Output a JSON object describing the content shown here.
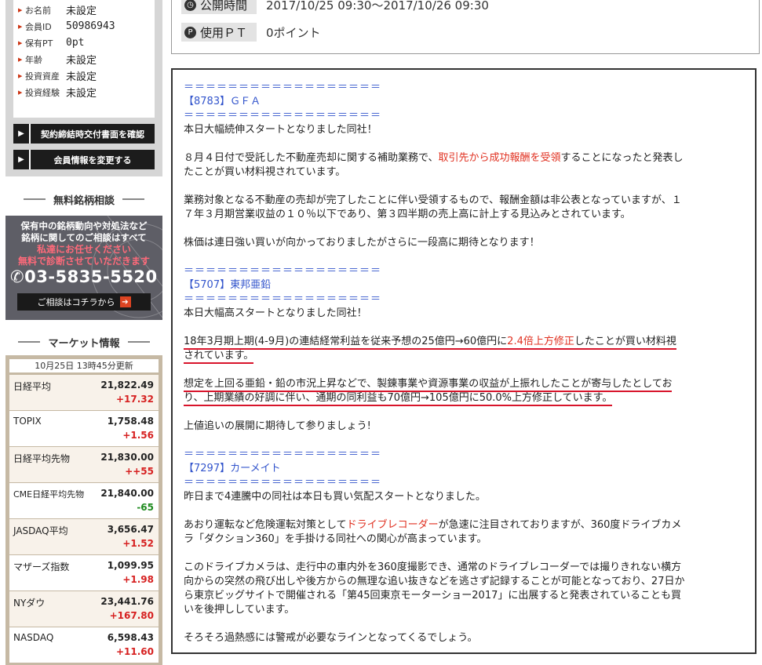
{
  "profile": {
    "rows": [
      {
        "label": "お名前",
        "value": "未設定"
      },
      {
        "label": "会員ID",
        "value": "50986943"
      },
      {
        "label": "保有PT",
        "value": "0pt"
      },
      {
        "label": "年齢",
        "value": "未設定"
      },
      {
        "label": "投資資産",
        "value": "未設定"
      },
      {
        "label": "投資経験",
        "value": "未設定"
      }
    ],
    "buttons": [
      "契約締結時交付書面を確認",
      "会員情報を変更する"
    ]
  },
  "consult": {
    "title": "無料銘柄相談",
    "line1": "保有中の銘柄動向や対処法など",
    "line2": "銘柄に関してのご相談はすべて",
    "line3": "私達にお任せください",
    "line4": "無料で診断させていただきます",
    "phone": "03-5835-5520",
    "button": "ご相談はコチラから"
  },
  "market": {
    "title": "マーケット情報",
    "updated": "10月25日 13時45分更新",
    "rows": [
      {
        "name": "日経平均",
        "price": "21,822.49",
        "change": "+17.32",
        "dir": "up"
      },
      {
        "name": "TOPIX",
        "price": "1,758.48",
        "change": "+1.56",
        "dir": "up"
      },
      {
        "name": "日経平均先物",
        "price": "21,830.00",
        "change": "++55",
        "dir": "up"
      },
      {
        "name": "CME日経平均先物",
        "price": "21,840.00",
        "change": "-65",
        "dir": "down"
      },
      {
        "name": "JASDAQ平均",
        "price": "3,656.47",
        "change": "+1.52",
        "dir": "up"
      },
      {
        "name": "マザーズ指数",
        "price": "1,099.95",
        "change": "+1.98",
        "dir": "up"
      },
      {
        "name": "NYダウ",
        "price": "23,441.76",
        "change": "+167.80",
        "dir": "up"
      },
      {
        "name": "NASDAQ",
        "price": "6,598.43",
        "change": "+11.60",
        "dir": "up"
      }
    ]
  },
  "info": {
    "publish_label": "公開時間",
    "publish_value": "2017/10/25 09:30～2017/10/26 09:30",
    "pt_label": "使用ＰＴ",
    "pt_value": "0ポイント"
  },
  "article": {
    "sep": "＝＝＝＝＝＝＝＝＝＝＝＝＝＝＝＝＝＝",
    "s1_code": "【8783】ＧＦＡ",
    "s1_p1": "本日大幅続伸スタートとなりました同社！",
    "s1_p2a": "８月４日付で受託した不動産売却に関する補助業務で、",
    "s1_p2b": "取引先から成功報酬を受領",
    "s1_p2c": "することになったと発表し",
    "s1_p2d": "たことが買い材料視されています。",
    "s1_p3a": "業務対象となる不動産の売却が完了したことに伴い受領するもので、報酬金額は非公表となっていますが、１",
    "s1_p3b": "７年３月期営業収益の１０％以下であり、第３四半期の売上高に計上する見込みとされています。",
    "s1_p4": "株価は連日強い買いが向かっておりましたがさらに一段高に期待となります！",
    "s2_code": "【5707】東邦亜鉛",
    "s2_p1": "本日大幅高スタートとなりました同社！",
    "s2_p2a": "18年3月期上期(4-9月)の連結経常利益を従来予想の25億円→60億円に",
    "s2_p2b": "2.4倍上方修正",
    "s2_p2c": "したことが買い材料視",
    "s2_p2d": "されています。",
    "s2_p3a": "想定を上回る亜鉛・鉛の市況上昇などで、製錬事業や資源事業の収益が上振れしたことが寄与したとしてお",
    "s2_p3b": "り、上期業績の好調に伴い、通期の同利益も70億円→105億円に50.0%上方修正しています。",
    "s2_p4": "上値追いの展開に期待して参りましょう!",
    "s3_code": "【7297】カーメイト",
    "s3_p1": "昨日まで4連騰中の同社は本日も買い気配スタートとなりました。",
    "s3_p2a": "あおり運転など危険運転対策として",
    "s3_p2b": "ドライブレコーダー",
    "s3_p2c": "が急速に注目されておりますが、360度ドライブカメ",
    "s3_p2d": "ラ「ダクション360」を手掛ける同社への関心が高まっています。",
    "s3_p3a": "このドライブカメラは、走行中の車内外を360度撮影でき、通常のドライブレコーダーでは撮りきれない横方",
    "s3_p3b": "向からの突然の飛び出しや後方からの無理な追い抜きなどを逃さず記録することが可能となっており、27日か",
    "s3_p3c": "ら東京ビッグサイトで開催される「第45回東京モーターショー2017」に出展すると発表されていることも買",
    "s3_p3d": "いを後押ししています。",
    "s3_p4": "そろそろ過熱感には警戒が必要なラインとなってくるでしょう。"
  }
}
